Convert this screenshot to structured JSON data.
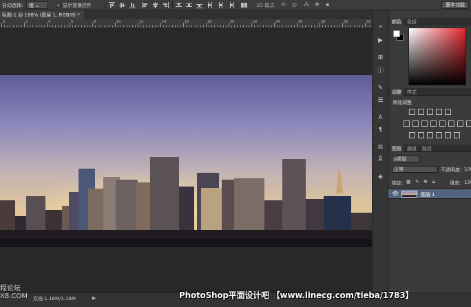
{
  "options_bar": {
    "auto_select_label": "自动选择:",
    "auto_select_value": "组",
    "show_transform_label": "显示变换控件",
    "mode_3d_label": "3D 模式:",
    "workspace_label": "基本功能"
  },
  "document": {
    "tab_title": "标题-1 @ 188% (图层 1, RGB/8) *",
    "status_size": "文档:1.16M/1.16M",
    "status_arrow": "▶"
  },
  "ruler": {
    "labels": [
      "0",
      "2",
      "4",
      "6",
      "8",
      "10",
      "12",
      "14",
      "16",
      "18",
      "20",
      "22",
      "24",
      "26",
      "28",
      "30",
      "32"
    ]
  },
  "color_panel": {
    "tabs": [
      "颜色",
      "色板"
    ]
  },
  "adjustments_panel": {
    "tabs": [
      "调整",
      "样式"
    ],
    "title": "添加调整"
  },
  "layers_panel": {
    "tabs": [
      "图层",
      "通道",
      "路径"
    ],
    "kind_filter": "ρ类型",
    "blend_mode": "正常",
    "opacity_label": "不透明度:",
    "opacity_value": "100",
    "lock_label": "锁定:",
    "fill_label": "填充:",
    "fill_value": "100",
    "layer_name": "图层 1"
  },
  "overlay": {
    "watermark_left": "程论坛\nX8.COM",
    "banner": "PhotoShop平面设计吧 【www.linecg.com/tieba/1783】"
  },
  "colors": {
    "picker_hue": "#e4262d",
    "selected_layer": "#52647d"
  }
}
